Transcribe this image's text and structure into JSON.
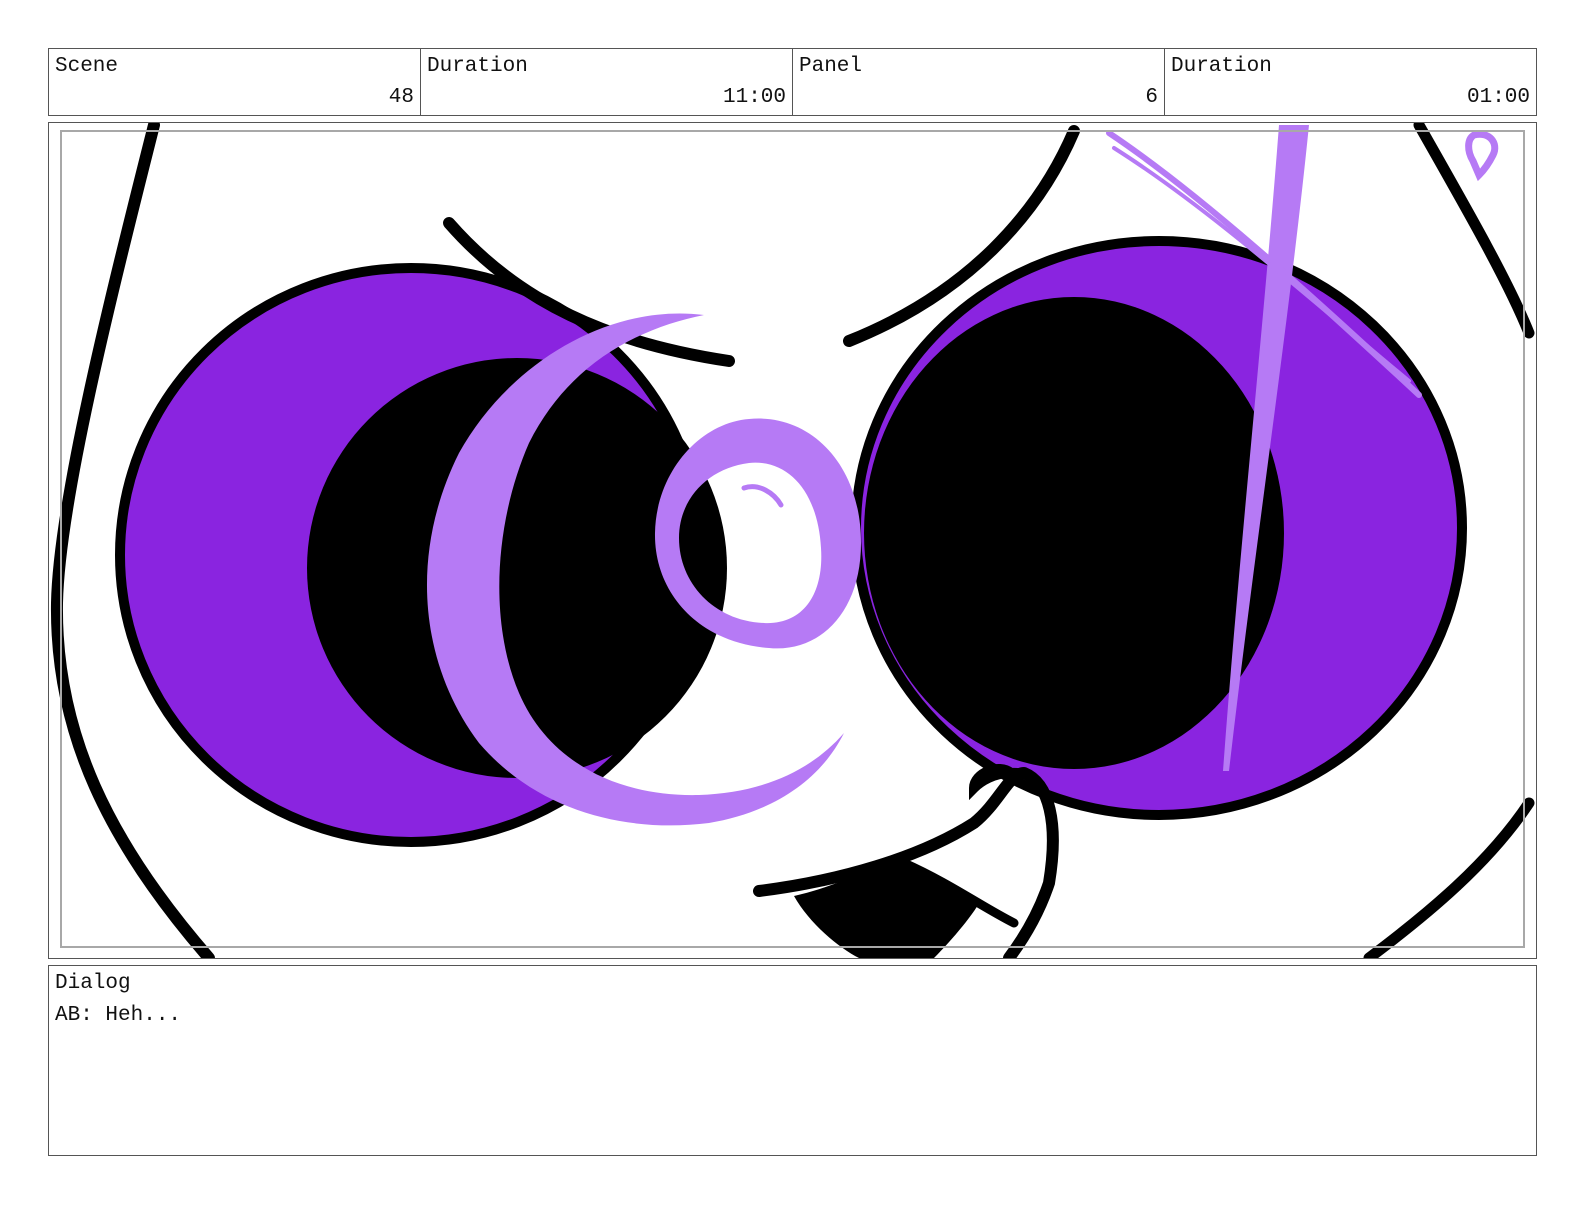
{
  "header": {
    "scene_label": "Scene",
    "scene_value": "48",
    "scene_duration_label": "Duration",
    "scene_duration_value": "11:00",
    "panel_label": "Panel",
    "panel_value": "6",
    "panel_duration_label": "Duration",
    "panel_duration_value": "01:00"
  },
  "dialog": {
    "label": "Dialog",
    "text": "AB: Heh..."
  },
  "colors": {
    "eye_purple": "#8a24e0",
    "effect_lavender": "#b67af5",
    "ink": "#000000"
  }
}
